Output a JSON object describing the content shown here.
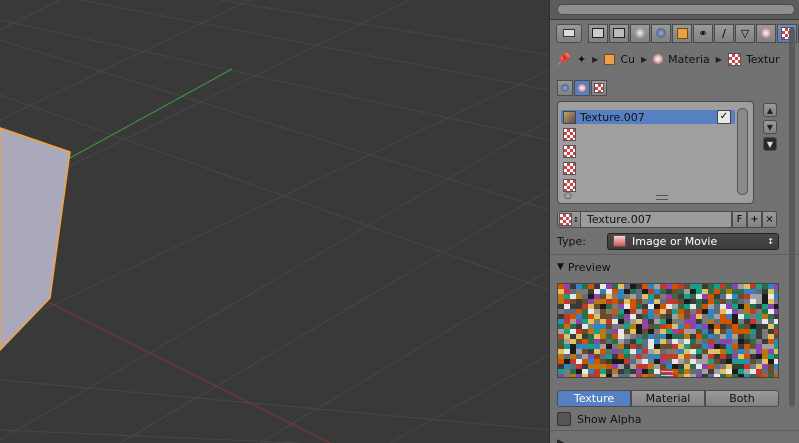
{
  "header": {
    "context_tabs": [
      "render-icon",
      "render-layers-icon",
      "scene-icon",
      "world-icon",
      "object-icon",
      "constraint-icon",
      "modifier-icon",
      "data-icon",
      "material-icon",
      "texture-icon",
      "particles-icon",
      "physics-icon"
    ],
    "active_tab": "texture-icon"
  },
  "breadcrumb": {
    "items": [
      {
        "icon": "object-cube-icon",
        "label": "Cu"
      },
      {
        "icon": "material-icon",
        "label": "Materia"
      },
      {
        "icon": "texture-icon",
        "label": "Textur"
      }
    ]
  },
  "texture_slots": {
    "items": [
      {
        "label": "Texture.007",
        "selected": true,
        "enabled": true
      },
      {
        "label": ""
      },
      {
        "label": ""
      },
      {
        "label": ""
      },
      {
        "label": ""
      }
    ]
  },
  "texture_id": {
    "name": "Texture.007",
    "fake_user_label": "F",
    "new_label": "+",
    "unlink_label": "×"
  },
  "type_row": {
    "label": "Type:",
    "value": "Image or Movie"
  },
  "preview": {
    "title": "Preview",
    "modes": [
      "Texture",
      "Material",
      "Both"
    ],
    "active_mode": "Texture"
  },
  "show_alpha": {
    "label": "Show Alpha",
    "checked": false
  },
  "colors": {
    "viewport_bg": "#393939",
    "panel_bg": "#727272",
    "accent_blue": "#5680c2",
    "selected_outline": "#f3a33a"
  }
}
